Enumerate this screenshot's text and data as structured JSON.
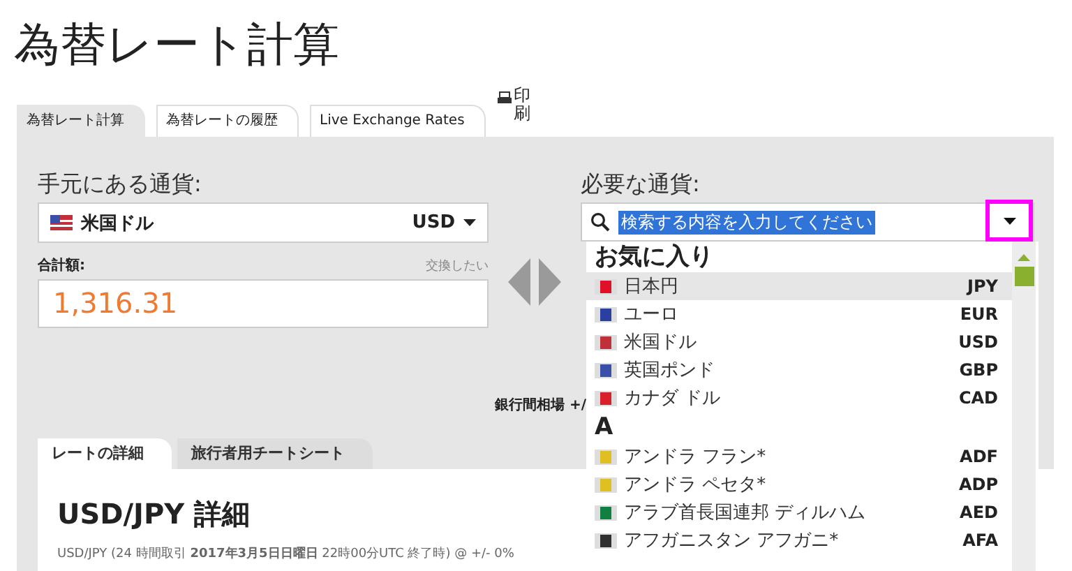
{
  "page_title": "為替レート計算",
  "tabs": [
    {
      "label": "為替レート計算",
      "selected": true
    },
    {
      "label": "為替レートの履歴",
      "selected": false
    },
    {
      "label": "Live Exchange Rates",
      "selected": false
    }
  ],
  "print_link": "印刷",
  "from": {
    "label": "手元にある通貨:",
    "currency_name": "米国ドル",
    "currency_code": "USD",
    "amount_label": "合計額:",
    "amount_hint": "交換したい",
    "amount": "1,316.31"
  },
  "to": {
    "label": "必要な通貨:",
    "search_value": "検索する内容を入力してください",
    "text_selected": true,
    "arrow_highlighted": true
  },
  "interbank_note": "銀行間相場 +/",
  "dropdown": {
    "sections": [
      {
        "heading": "お気に入り",
        "items": [
          {
            "name": "日本円",
            "code": "JPY",
            "color": "#e0102a",
            "selected": true
          },
          {
            "name": "ユーロ",
            "code": "EUR",
            "color": "#2a3fa0",
            "selected": false
          },
          {
            "name": "米国ドル",
            "code": "USD",
            "color": "#c0303a",
            "selected": false
          },
          {
            "name": "英国ポンド",
            "code": "GBP",
            "color": "#3a4fa8",
            "selected": false
          },
          {
            "name": "カナダ ドル",
            "code": "CAD",
            "color": "#d8202a",
            "selected": false
          }
        ]
      },
      {
        "heading": "A",
        "items": [
          {
            "name": "アンドラ フラン*",
            "code": "ADF",
            "color": "#e0c020",
            "selected": false
          },
          {
            "name": "アンドラ ペセタ*",
            "code": "ADP",
            "color": "#e0c020",
            "selected": false
          },
          {
            "name": "アラブ首長国連邦 ディルハム",
            "code": "AED",
            "color": "#108040",
            "selected": false
          },
          {
            "name": "アフガニスタン アフガニ*",
            "code": "AFA",
            "color": "#303030",
            "selected": false
          }
        ]
      }
    ]
  },
  "detail_tabs": [
    {
      "label": "レートの詳細",
      "selected": true
    },
    {
      "label": "旅行者用チートシート",
      "selected": false
    }
  ],
  "detail": {
    "heading": "USD/JPY 詳細",
    "subtext": "USD/JPY (24 時間取引 **2017年3月5日日曜日** 22時00分UTC 終了時) @ +/- 0%"
  }
}
